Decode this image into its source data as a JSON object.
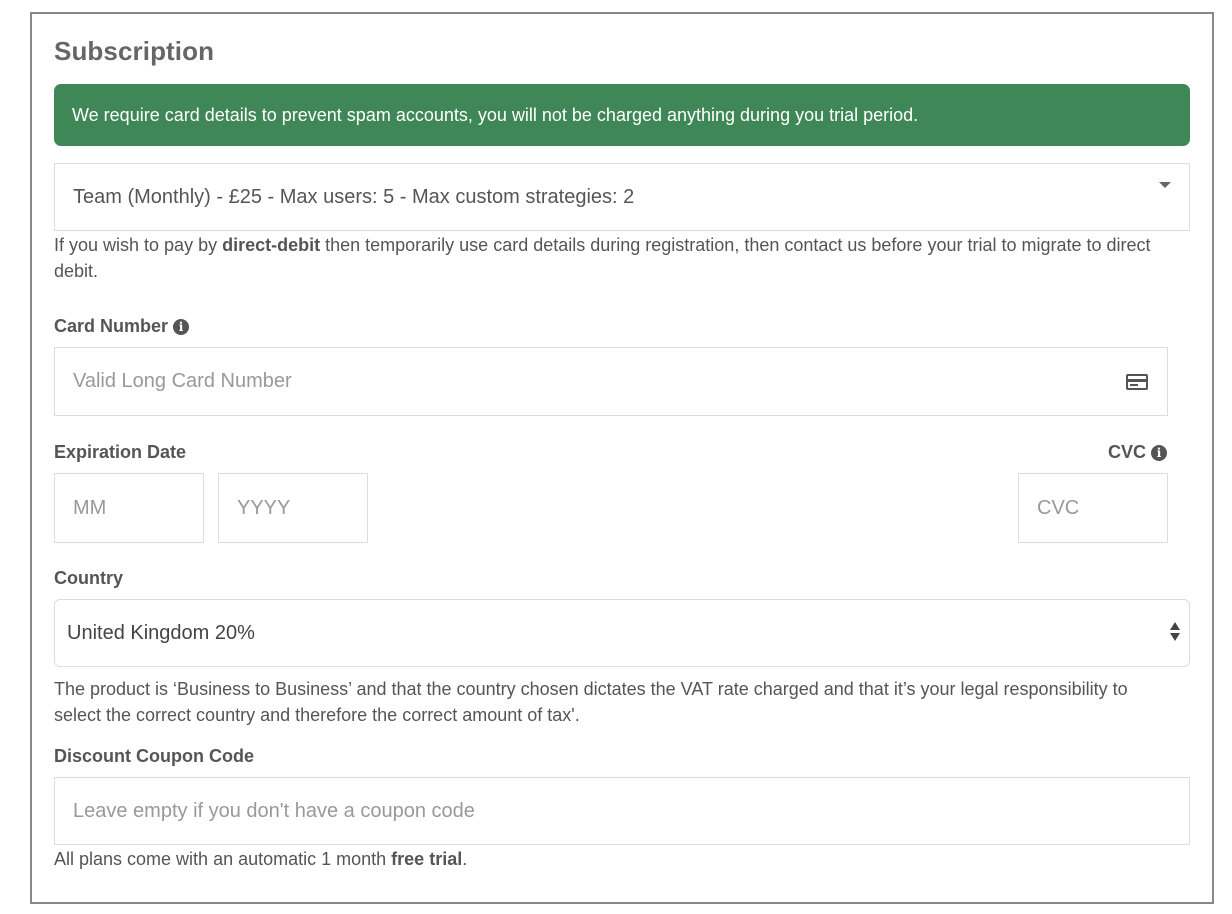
{
  "form": {
    "title": "Subscription",
    "alert": "We require card details to prevent spam accounts, you will not be charged anything during you trial period.",
    "plan": {
      "selected": "Team (Monthly) - £25 - Max users: 5 - Max custom strategies: 2"
    },
    "direct_debit_help": {
      "prefix": "If you wish to pay by ",
      "bold": "direct-debit",
      "suffix": " then temporarily use card details during registration, then contact us before your trial to migrate to direct debit."
    },
    "card_number": {
      "label": "Card Number",
      "placeholder": "Valid Long Card Number",
      "addon_icon": "credit-card-icon",
      "info_icon": "info-circle-icon"
    },
    "expiration": {
      "label": "Expiration Date",
      "month_placeholder": "MM",
      "year_placeholder": "YYYY"
    },
    "cvc": {
      "label": "CVC",
      "placeholder": "CVC",
      "info_icon": "info-circle-icon"
    },
    "country": {
      "label": "Country",
      "selected": "United Kingdom 20%",
      "help": "The product is ‘Business to Business’ and that the country chosen dictates the VAT rate charged and that it’s your legal responsibility to select the correct country and therefore the correct amount of tax'."
    },
    "coupon": {
      "label": "Discount Coupon Code",
      "placeholder": "Leave empty if you don't have a coupon code"
    },
    "trial_note": {
      "prefix": "All plans come with an automatic 1 month ",
      "bold": "free trial",
      "suffix": "."
    }
  },
  "colors": {
    "alert_bg": "#3f8757",
    "border": "#dddddd",
    "panel_border": "#888888",
    "text": "#555555"
  }
}
